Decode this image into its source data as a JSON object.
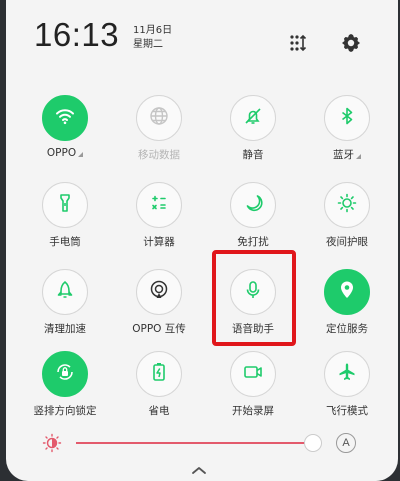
{
  "status": {
    "time": "16:13",
    "date": "11月6日",
    "weekday": "星期二"
  },
  "header_icons": [
    "grid-toggle-icon",
    "settings-icon"
  ],
  "tiles": [
    {
      "label": "OPPO",
      "icon": "wifi-icon",
      "state": "on",
      "has_arrow": true
    },
    {
      "label": "移动数据",
      "icon": "globe-icon",
      "state": "disabled",
      "has_arrow": false
    },
    {
      "label": "静音",
      "icon": "bell-mute-icon",
      "state": "off",
      "has_arrow": false
    },
    {
      "label": "蓝牙",
      "icon": "bluetooth-icon",
      "state": "off",
      "has_arrow": true
    },
    {
      "label": "手电筒",
      "icon": "flashlight-icon",
      "state": "off",
      "has_arrow": false
    },
    {
      "label": "计算器",
      "icon": "calculator-icon",
      "state": "off",
      "has_arrow": false
    },
    {
      "label": "免打扰",
      "icon": "moon-icon",
      "state": "off",
      "has_arrow": false
    },
    {
      "label": "夜间护眼",
      "icon": "eye-care-icon",
      "state": "off",
      "has_arrow": false
    },
    {
      "label": "清理加速",
      "icon": "rocket-icon",
      "state": "off",
      "has_arrow": false
    },
    {
      "label": "OPPO 互传",
      "icon": "share-icon",
      "state": "off",
      "has_arrow": false
    },
    {
      "label": "语音助手",
      "icon": "microphone-icon",
      "state": "off",
      "has_arrow": false
    },
    {
      "label": "定位服务",
      "icon": "location-icon",
      "state": "on",
      "has_arrow": false
    },
    {
      "label": "竖排方向锁定",
      "icon": "rotation-lock-icon",
      "state": "on",
      "has_arrow": false
    },
    {
      "label": "省电",
      "icon": "battery-saver-icon",
      "state": "off",
      "has_arrow": false
    },
    {
      "label": "开始录屏",
      "icon": "screen-record-icon",
      "state": "off",
      "has_arrow": false
    },
    {
      "label": "飞行模式",
      "icon": "airplane-icon",
      "state": "off",
      "has_arrow": false
    }
  ],
  "brightness": {
    "level": 0.9,
    "auto_label": "A"
  },
  "colors": {
    "accent": "#1ecb6b",
    "highlight": "#e0161b",
    "slider": "#e35a6c"
  }
}
